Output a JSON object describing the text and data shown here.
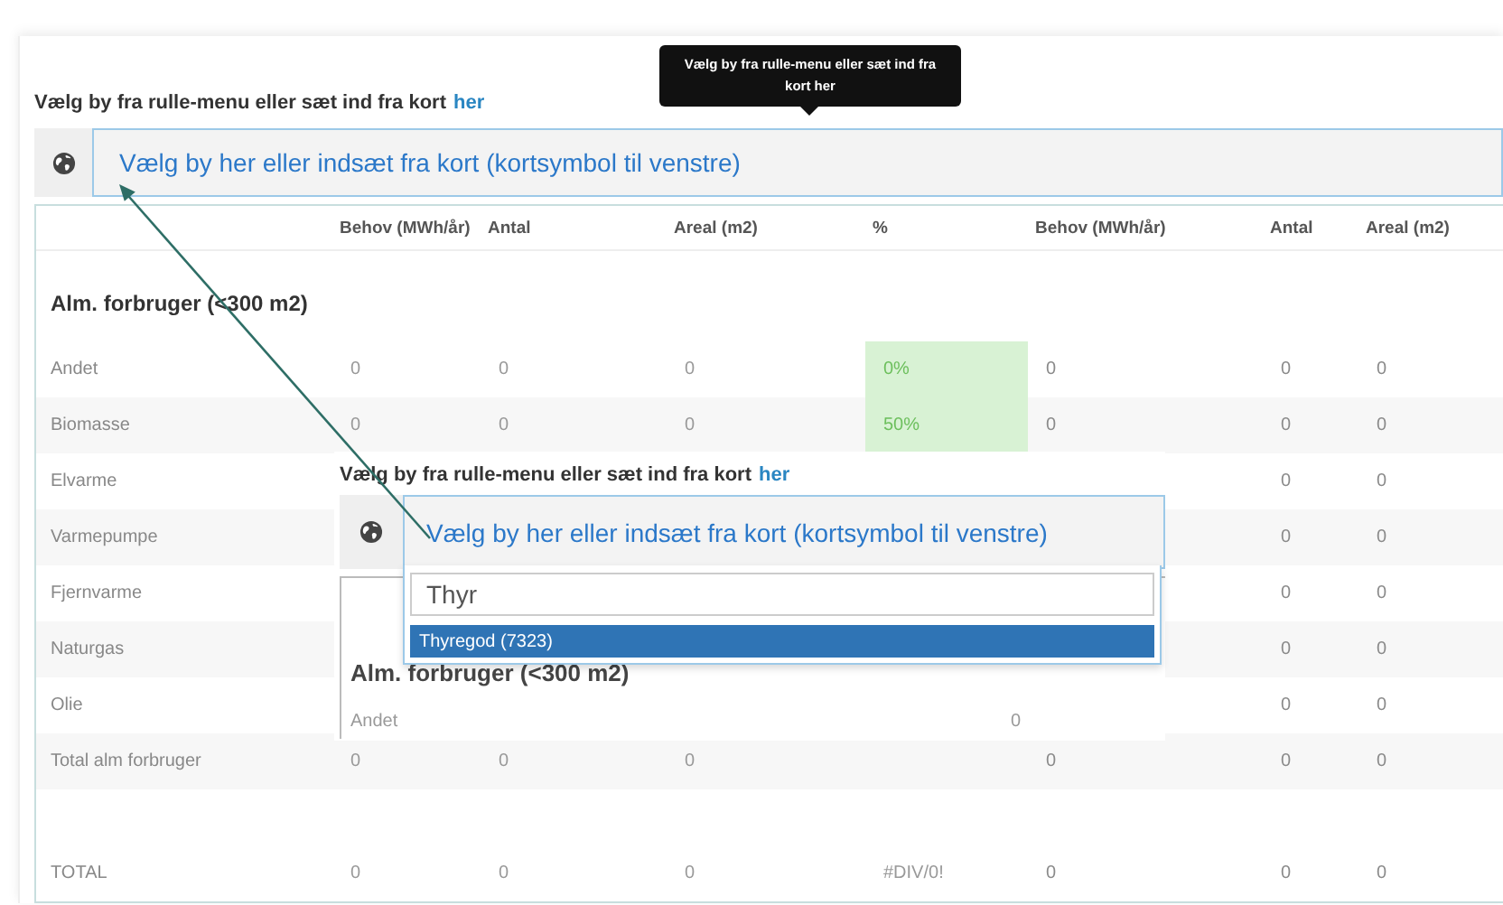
{
  "tooltip": {
    "text": "Vælg by fra rulle-menu eller sæt ind fra kort her"
  },
  "picker": {
    "label": "Vælg by fra rulle-menu eller sæt ind fra kort",
    "link": "her",
    "prompt": "Vælg by her eller indsæt fra kort (kortsymbol til venstre)"
  },
  "table": {
    "columns": [
      "Behov (MWh/år)",
      "Antal",
      "Areal (m2)",
      "%",
      "Behov (MWh/år)",
      "Antal",
      "Areal (m2)"
    ],
    "section": "Alm. forbruger (<300 m2)",
    "rows": [
      {
        "label": "Andet",
        "kind": "item",
        "highlighted": true,
        "cells": [
          "0",
          "0",
          "0",
          "0%",
          "0",
          "0",
          "0"
        ]
      },
      {
        "label": "Biomasse",
        "kind": "item",
        "highlighted": true,
        "cells": [
          "0",
          "0",
          "0",
          "50%",
          "0",
          "0",
          "0"
        ]
      },
      {
        "label": "Elvarme",
        "kind": "item",
        "cells": [
          null,
          null,
          null,
          null,
          null,
          "0",
          "0"
        ]
      },
      {
        "label": "Varmepumpe",
        "kind": "item",
        "cells": [
          null,
          null,
          null,
          null,
          null,
          "0",
          "0"
        ]
      },
      {
        "label": "Fjernvarme",
        "kind": "item",
        "cells": [
          null,
          null,
          null,
          null,
          null,
          "0",
          "0"
        ]
      },
      {
        "label": "Naturgas",
        "kind": "item",
        "cells": [
          null,
          null,
          null,
          null,
          null,
          "0",
          "0"
        ]
      },
      {
        "label": "Olie",
        "kind": "item",
        "cells": [
          null,
          null,
          null,
          null,
          null,
          "0",
          "0"
        ]
      },
      {
        "label": "Total alm forbruger",
        "kind": "subtotal",
        "cells": [
          "0",
          "0",
          "0",
          null,
          "0",
          "0",
          "0"
        ]
      },
      {
        "label": "TOTAL",
        "kind": "total",
        "highlighted": false,
        "cells": [
          "0",
          "0",
          "0",
          "#DIV/0!",
          "0",
          "0",
          "0"
        ]
      }
    ]
  },
  "inset": {
    "picker": {
      "label": "Vælg by fra rulle-menu eller sæt ind fra kort",
      "link": "her",
      "prompt": "Vælg by her eller indsæt fra kort (kortsymbol til venstre)"
    },
    "search_value": "Thyr",
    "options": [
      {
        "label": "Thyregod (7323)",
        "selected": true
      }
    ],
    "section": "Alm. forbruger (<300 m2)",
    "row_label": "Andet",
    "value": "0"
  }
}
